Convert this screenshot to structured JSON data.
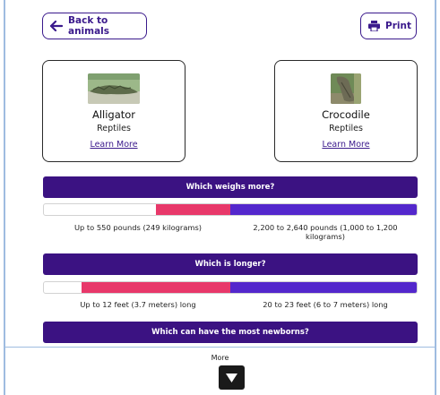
{
  "toolbar": {
    "back_label": "Back to animals",
    "print_label": "Print"
  },
  "animals": [
    {
      "name": "Alligator",
      "category": "Reptiles",
      "link": "Learn More"
    },
    {
      "name": "Crocodile",
      "category": "Reptiles",
      "link": "Learn More"
    }
  ],
  "comparisons": [
    {
      "question": "Which weighs more?",
      "left_label": "Up to 550 pounds (249 kilograms)",
      "right_label": "2,200 to 2,640 pounds (1,000 to 1,200 kilograms)",
      "left_share": 0.2,
      "right_share": 0.5
    },
    {
      "question": "Which is longer?",
      "left_label": "Up to 12 feet (3.7 meters) long",
      "right_label": "20 to 23 feet (6 to 7 meters) long",
      "left_share": 0.4,
      "right_share": 0.5
    },
    {
      "question": "Which can have the most newborns?"
    }
  ],
  "more": {
    "label": "More"
  },
  "colors": {
    "header": "#3b1282",
    "left_fill": "#e8386a",
    "right_fill": "#5327cc"
  },
  "icons": {
    "back": "arrow-left-icon",
    "print": "printer-icon",
    "more": "triangle-down-icon"
  }
}
